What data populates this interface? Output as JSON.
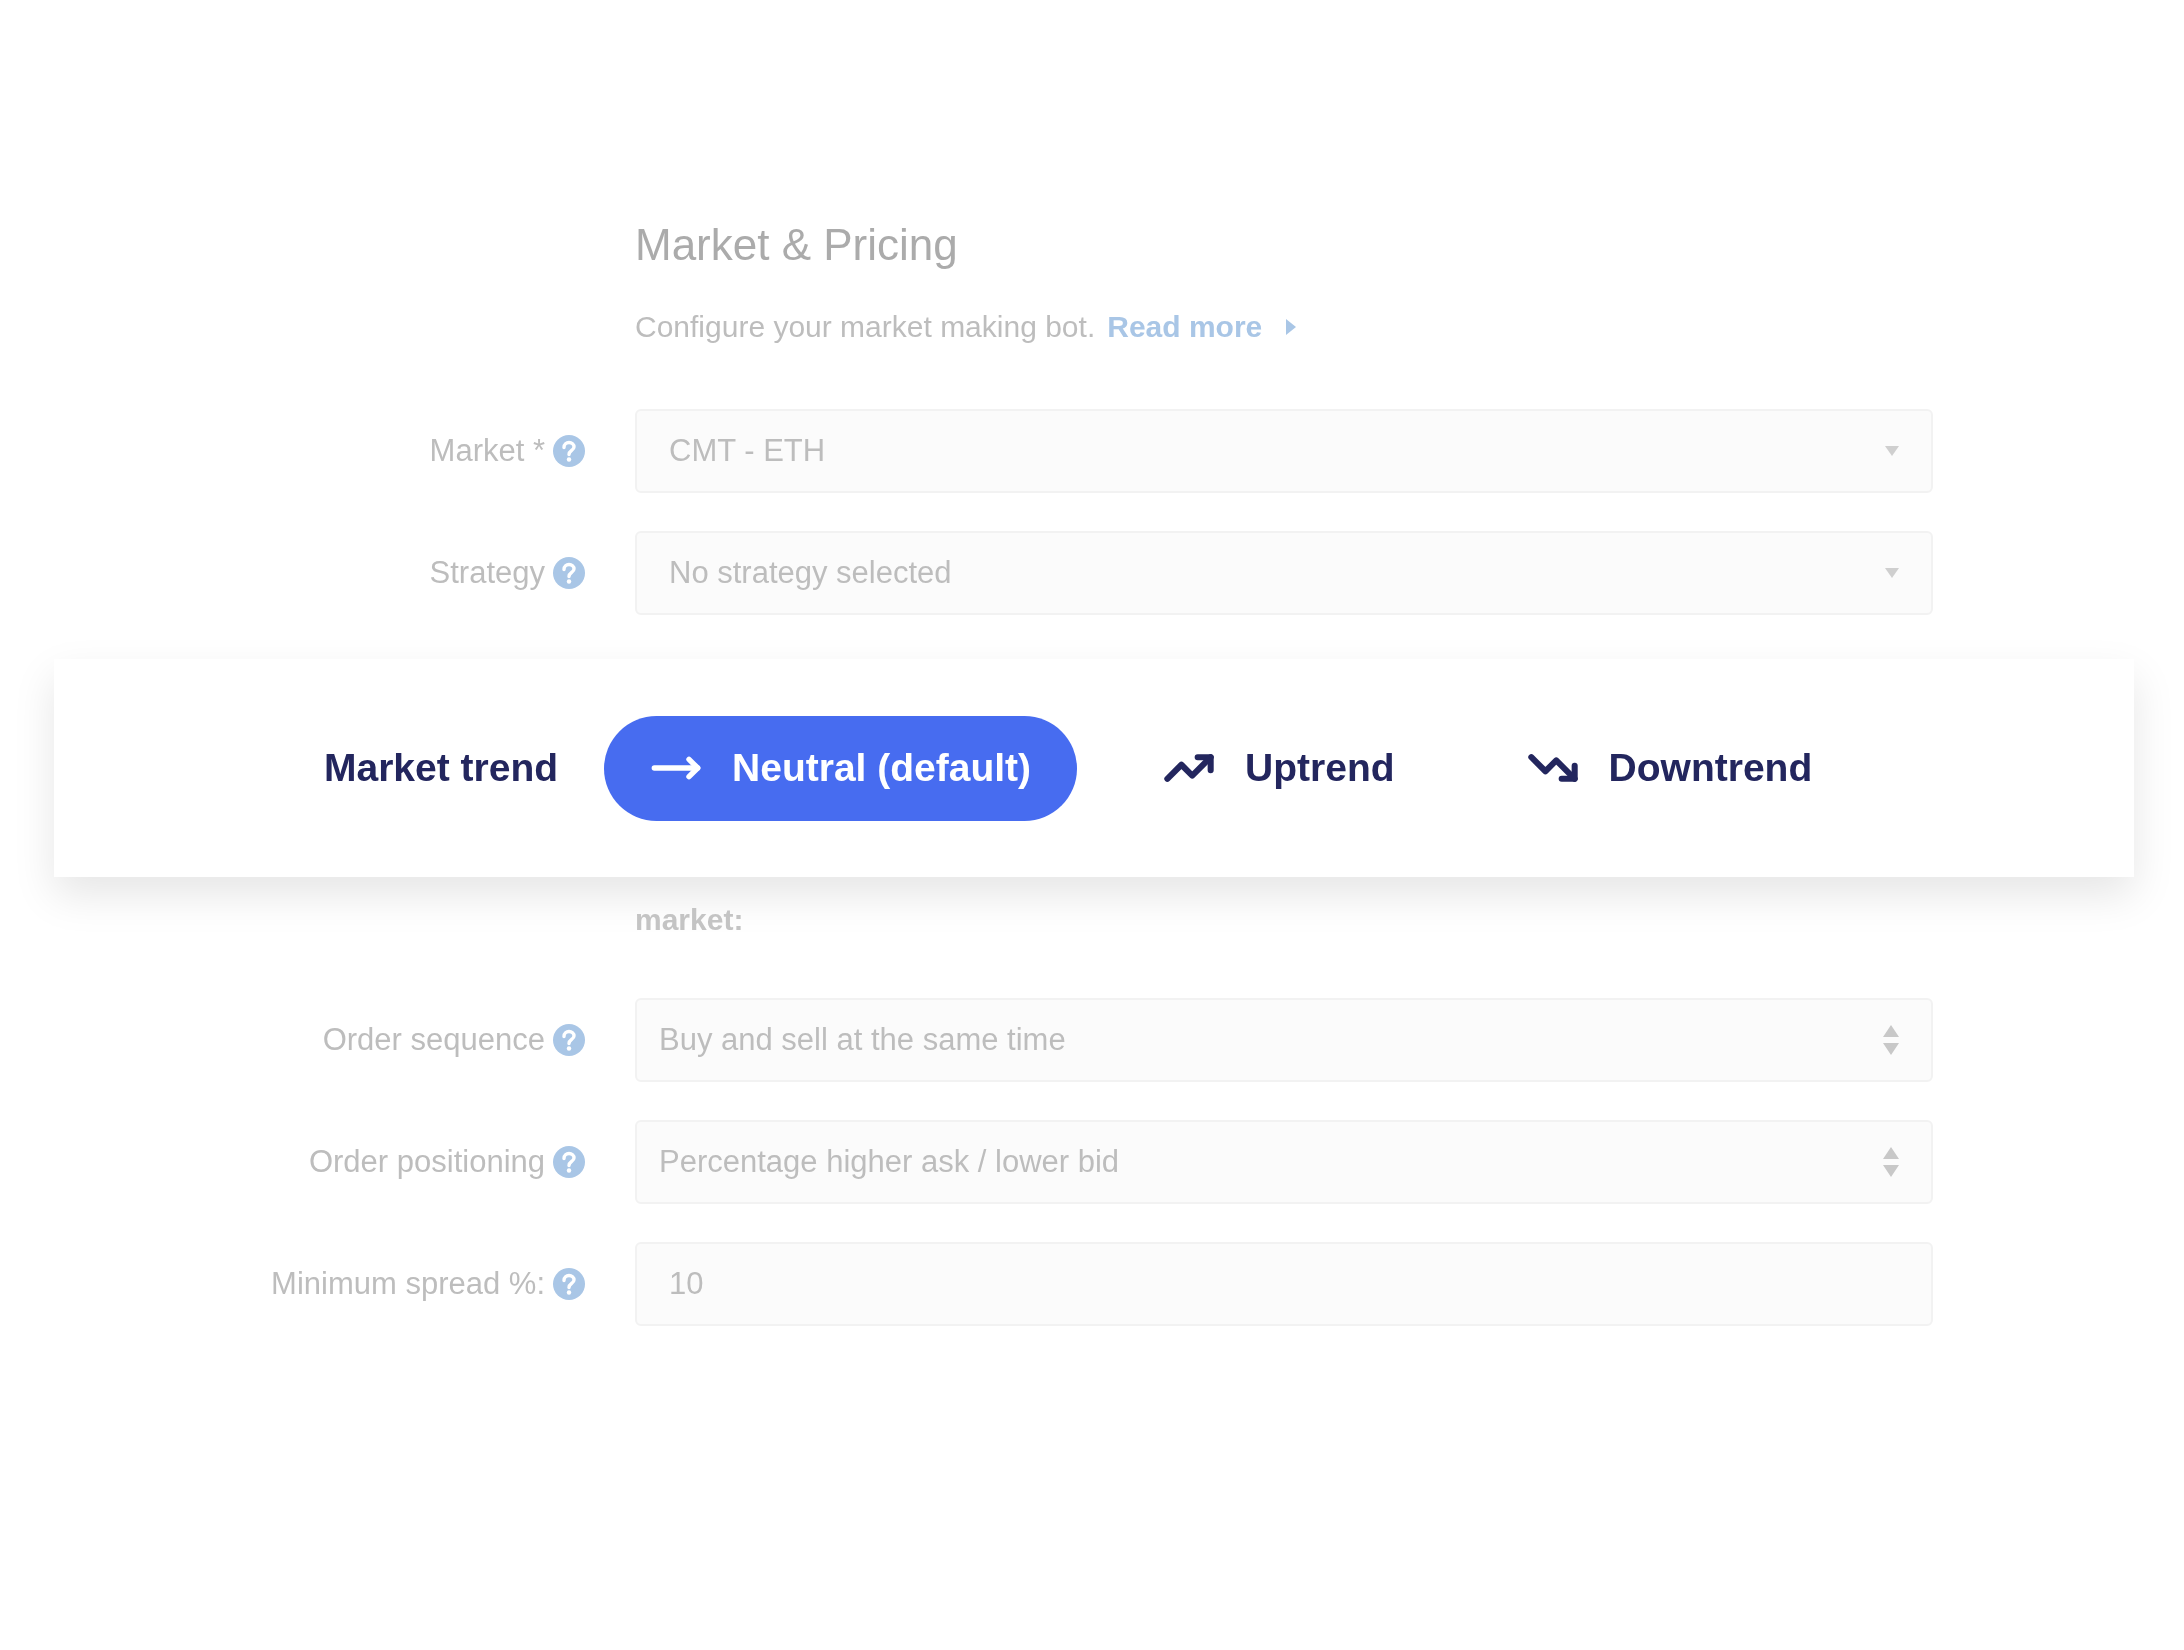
{
  "section": {
    "title": "Market & Pricing",
    "description": "Configure your market making bot.",
    "link": "Read more"
  },
  "fields_top": [
    {
      "label": "Market *",
      "kind": "select",
      "value": "CMT - ETH"
    },
    {
      "label": "Strategy",
      "kind": "select",
      "value": "No strategy selected"
    }
  ],
  "market_trend": {
    "label": "Market trend",
    "options": [
      {
        "label": "Neutral (default)",
        "kind": "flat",
        "selected": true
      },
      {
        "label": "Uptrend",
        "kind": "up",
        "selected": false
      },
      {
        "label": "Downtrend",
        "kind": "down",
        "selected": false
      }
    ]
  },
  "note": "market:",
  "fields_bottom": [
    {
      "label": "Order sequence",
      "kind": "stepper",
      "value": "Buy and sell at the same time"
    },
    {
      "label": "Order positioning",
      "kind": "stepper",
      "value": "Percentage higher ask / lower bid"
    },
    {
      "label": "Minimum spread %:",
      "kind": "text",
      "value": "10"
    }
  ]
}
